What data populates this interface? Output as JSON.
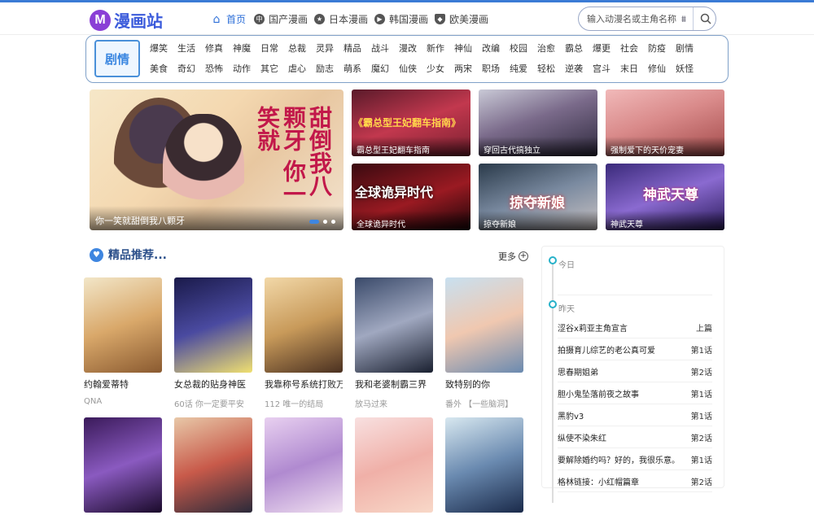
{
  "header": {
    "logo_mark": "M",
    "logo_text": "漫画站",
    "nav": [
      {
        "label": "首页",
        "icon": "home-icon",
        "active": true
      },
      {
        "label": "国产漫画",
        "icon": "china-icon",
        "active": false
      },
      {
        "label": "日本漫画",
        "icon": "star-icon",
        "active": false
      },
      {
        "label": "韩国漫画",
        "icon": "play-icon",
        "active": false
      },
      {
        "label": "欧美漫画",
        "icon": "shield-icon",
        "active": false
      }
    ],
    "search_placeholder": "输入动漫名或主角名称"
  },
  "genres": {
    "badge": "剧情",
    "tags": [
      "爆笑",
      "生活",
      "修真",
      "神魔",
      "日常",
      "总裁",
      "灵异",
      "精品",
      "战斗",
      "漫改",
      "新作",
      "神仙",
      "改编",
      "校园",
      "治愈",
      "霸总",
      "爆更",
      "社会",
      "防疫",
      "剧情",
      "美食",
      "奇幻",
      "恐怖",
      "动作",
      "其它",
      "虐心",
      "励志",
      "萌系",
      "魔幻",
      "仙侠",
      "少女",
      "两宋",
      "职场",
      "纯爱",
      "轻松",
      "逆袭",
      "宫斗",
      "末日",
      "修仙",
      "妖怪"
    ]
  },
  "banners": {
    "main": {
      "caption": "你一笑就甜倒我八颗牙",
      "art_text": "甜倒我八颗牙 你一笑就"
    },
    "items": [
      {
        "caption": "霸总型王妃翻车指南",
        "overlay": "《霸总型王妃翻车指南》"
      },
      {
        "caption": "穿回古代搞独立",
        "overlay": ""
      },
      {
        "caption": "强制爱下的天价宠妻",
        "overlay": ""
      },
      {
        "caption": "全球诡异时代",
        "overlay": "全球诡异时代"
      },
      {
        "caption": "掠夺新娘",
        "overlay": "掠夺新娘"
      },
      {
        "caption": "神武天尊",
        "overlay": "神武天尊"
      }
    ]
  },
  "featured": {
    "title": "精品推荐...",
    "more_label": "更多",
    "cards": [
      {
        "title": "约翰爱蒂特",
        "sub": "QNA"
      },
      {
        "title": "女总裁的贴身神医",
        "sub": "60话 你一定要平安"
      },
      {
        "title": "我靠称号系统打败万",
        "sub": "112 唯一的结局"
      },
      {
        "title": "我和老婆制霸三界",
        "sub": "放马过来"
      },
      {
        "title": "致特别的你",
        "sub": "番外 【一些脑洞】"
      },
      {
        "title": "",
        "sub": ""
      },
      {
        "title": "",
        "sub": ""
      },
      {
        "title": "",
        "sub": ""
      },
      {
        "title": "",
        "sub": ""
      },
      {
        "title": "",
        "sub": ""
      }
    ]
  },
  "updates": {
    "today_label": "今日",
    "yesterday_label": "昨天",
    "rows": [
      {
        "name": "涩谷x莉亚主角宣言",
        "ep": "上篇"
      },
      {
        "name": "拍摄育儿综艺的老公真可爱",
        "ep": "第1话"
      },
      {
        "name": "思春期姐弟",
        "ep": "第2话"
      },
      {
        "name": "胆小鬼坠落前夜之故事",
        "ep": "第1话"
      },
      {
        "name": "黑豹v3",
        "ep": "第1话"
      },
      {
        "name": "纵使不染朱红",
        "ep": "第2话"
      },
      {
        "name": "要解除婚约吗？好的，我很乐意。因",
        "ep": "第1话"
      },
      {
        "name": "格林链接：小红帽篇章",
        "ep": "第2话"
      }
    ]
  },
  "colors": {
    "accent": "#2e6fd8",
    "brand": "#8a3fd6",
    "timeline": "#27b1c9"
  }
}
